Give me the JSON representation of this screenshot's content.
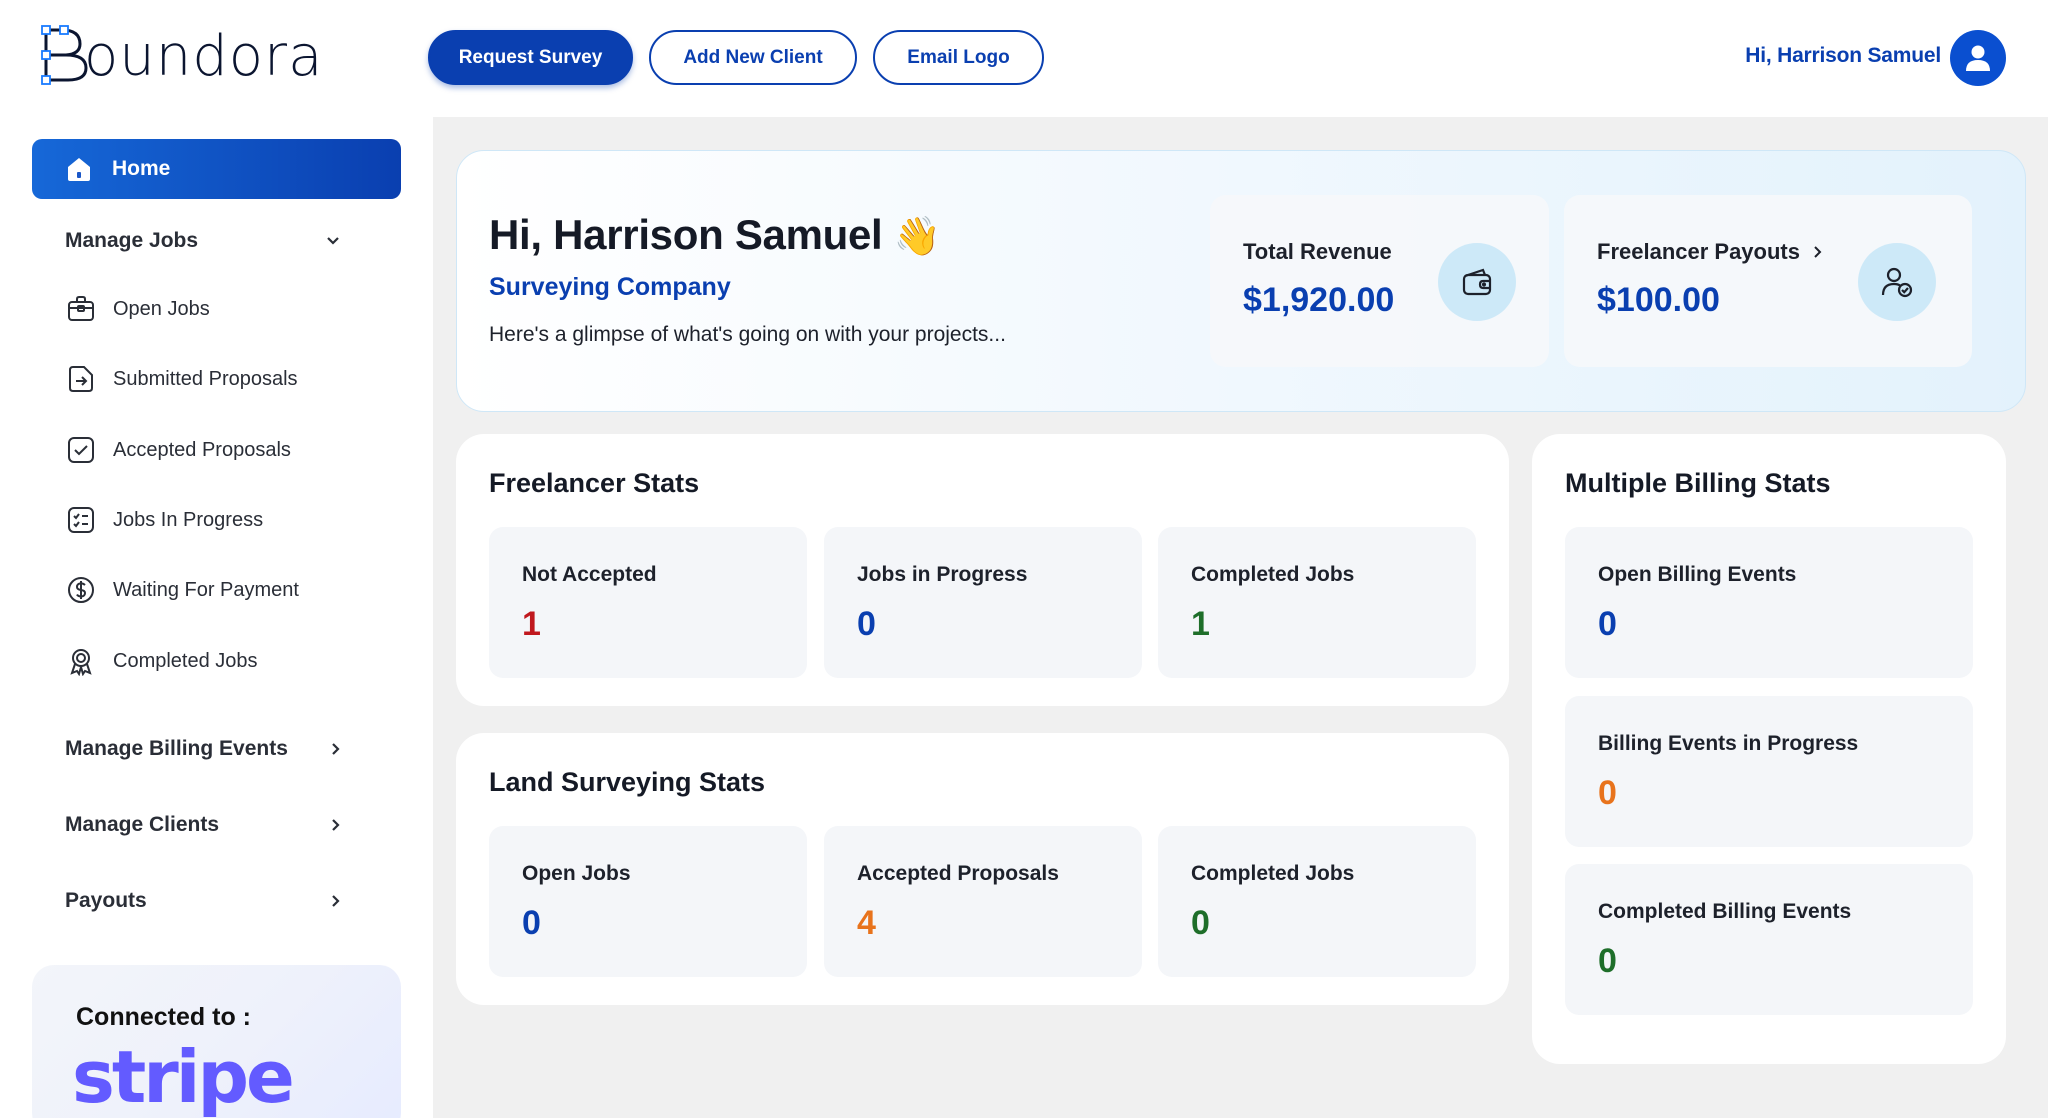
{
  "brand": {
    "name": "Boundora"
  },
  "header": {
    "request_survey": "Request Survey",
    "add_new_client": "Add New Client",
    "email_logo": "Email Logo",
    "user_greeting": "Hi, Harrison Samuel"
  },
  "sidebar": {
    "home": "Home",
    "manage_jobs": "Manage Jobs",
    "jobs_items": [
      {
        "label": "Open Jobs",
        "icon": "briefcase-icon"
      },
      {
        "label": "Submitted Proposals",
        "icon": "file-arrow-icon"
      },
      {
        "label": "Accepted Proposals",
        "icon": "checkbox-icon"
      },
      {
        "label": "Jobs In Progress",
        "icon": "checklist-icon"
      },
      {
        "label": "Waiting For Payment",
        "icon": "dollar-circle-icon"
      },
      {
        "label": "Completed Jobs",
        "icon": "award-icon"
      }
    ],
    "manage_billing_events": "Manage Billing Events",
    "manage_clients": "Manage Clients",
    "payouts": "Payouts",
    "connected_label": "Connected to :",
    "stripe_logo": "stripe"
  },
  "hero": {
    "greeting": "Hi, Harrison Samuel",
    "emoji": "👋",
    "company": "Surveying Company",
    "description": "Here's a glimpse of what's going on with your projects...",
    "total_revenue_label": "Total Revenue",
    "total_revenue_value": "$1,920.00",
    "freelancer_payouts_label": "Freelancer Payouts",
    "freelancer_payouts_value": "$100.00"
  },
  "freelancer_stats": {
    "title": "Freelancer Stats",
    "items": [
      {
        "label": "Not Accepted",
        "value": "1",
        "color": "#c0181e"
      },
      {
        "label": "Jobs in Progress",
        "value": "0",
        "color": "#0a3fb0"
      },
      {
        "label": "Completed Jobs",
        "value": "1",
        "color": "#1e6e2a"
      }
    ]
  },
  "land_stats": {
    "title": "Land Surveying Stats",
    "items": [
      {
        "label": "Open Jobs",
        "value": "0",
        "color": "#0a3fb0"
      },
      {
        "label": "Accepted Proposals",
        "value": "4",
        "color": "#e8731c"
      },
      {
        "label": "Completed Jobs",
        "value": "0",
        "color": "#1e6e2a"
      }
    ]
  },
  "billing_stats": {
    "title": "Multiple Billing Stats",
    "items": [
      {
        "label": "Open Billing Events",
        "value": "0",
        "color": "#0a3fb0"
      },
      {
        "label": "Billing Events in Progress",
        "value": "0",
        "color": "#e8731c"
      },
      {
        "label": "Completed Billing Events",
        "value": "0",
        "color": "#1e6e2a"
      }
    ]
  },
  "colors": {
    "accent": "#0a3fb0",
    "stripe": "#635bff"
  }
}
